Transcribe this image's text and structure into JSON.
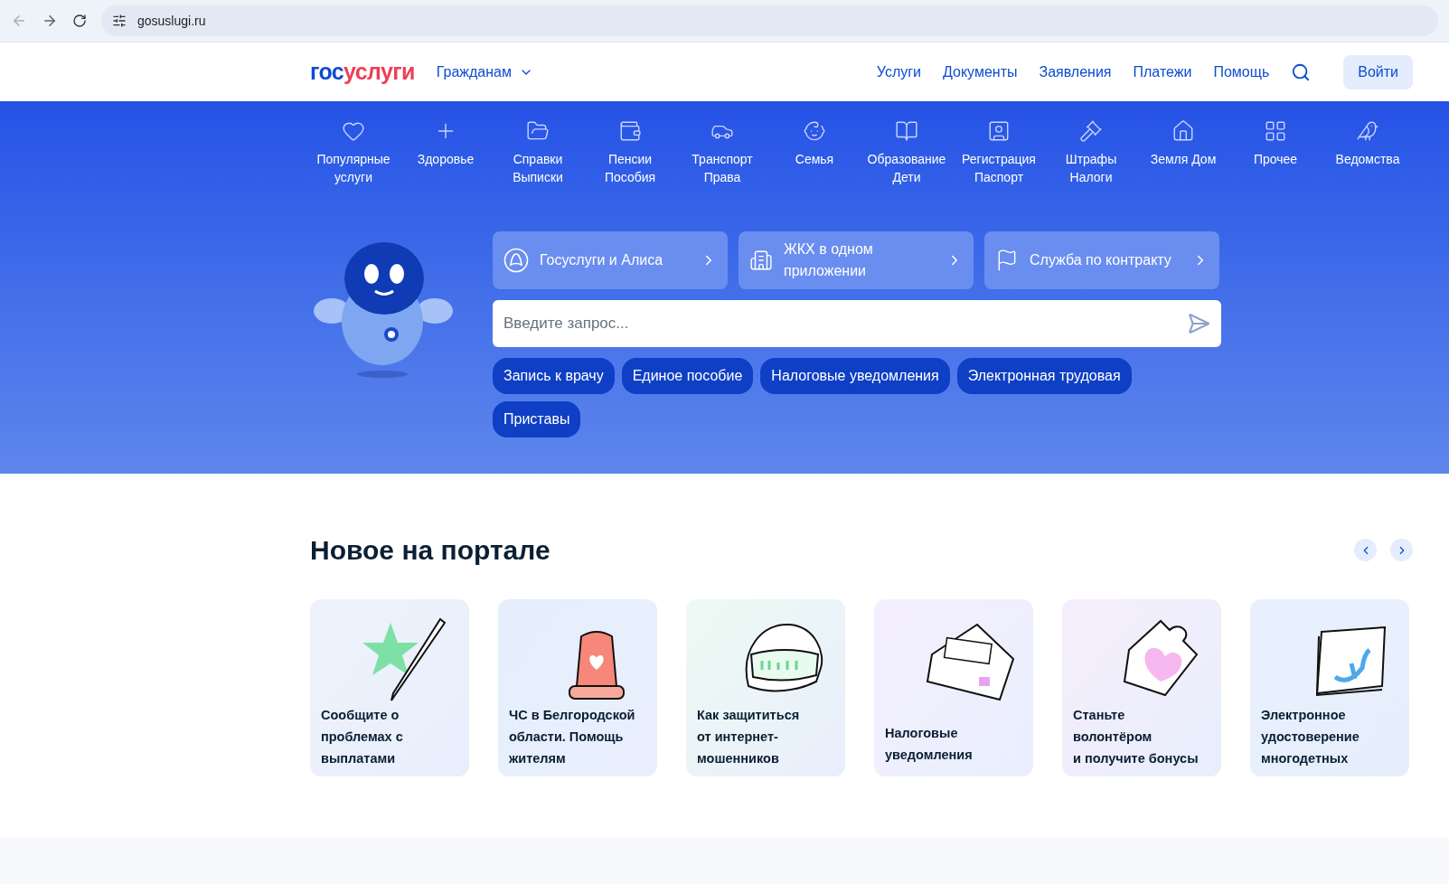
{
  "browser": {
    "url": "gosuslugi.ru"
  },
  "header": {
    "logo": [
      {
        "text": "гос",
        "color": "#0d4cd3"
      },
      {
        "text": "услуги",
        "color": "#ee3f58"
      }
    ],
    "audience": "Гражданам",
    "links": [
      "Услуги",
      "Документы",
      "Заявления",
      "Платежи",
      "Помощь"
    ],
    "login": "Войти"
  },
  "categories": [
    {
      "lines": [
        "Популярные",
        "услуги"
      ]
    },
    {
      "lines": [
        "Здоровье"
      ]
    },
    {
      "lines": [
        "Справки",
        "Выписки"
      ]
    },
    {
      "lines": [
        "Пенсии",
        "Пособия"
      ]
    },
    {
      "lines": [
        "Транспорт",
        "Права"
      ]
    },
    {
      "lines": [
        "Семья"
      ]
    },
    {
      "lines": [
        "Образование",
        "Дети"
      ]
    },
    {
      "lines": [
        "Регистрация",
        "Паспорт"
      ]
    },
    {
      "lines": [
        "Штрафы",
        "Налоги"
      ]
    },
    {
      "lines": [
        "Земля Дом"
      ]
    },
    {
      "lines": [
        "Прочее"
      ]
    },
    {
      "lines": [
        "Ведомства"
      ]
    }
  ],
  "promos": [
    {
      "lines": [
        "Госуслуги и Алиса"
      ]
    },
    {
      "lines": [
        "ЖКХ в одном",
        "приложении"
      ]
    },
    {
      "lines": [
        "Служба по контракту"
      ]
    }
  ],
  "search": {
    "placeholder": "Введите запрос..."
  },
  "quick_links": [
    "Запись к врачу",
    "Единое пособие",
    "Налоговые уведомления",
    "Электронная трудовая",
    "Приставы"
  ],
  "news": {
    "title": "Новое на портале",
    "cards": [
      {
        "lines": [
          "Сообщите о",
          "проблемах с",
          "выплатами"
        ]
      },
      {
        "lines": [
          "ЧС в Белгородской",
          "области. Помощь",
          "жителям"
        ]
      },
      {
        "lines": [
          "Как защититься",
          "от интернет-",
          "мошенников"
        ]
      },
      {
        "lines": [
          "Налоговые",
          "уведомления"
        ]
      },
      {
        "lines": [
          "Станьте",
          "волонтёром",
          "и получите бонусы"
        ]
      },
      {
        "lines": [
          "Электронное",
          "удостоверение",
          "многодетных"
        ]
      }
    ]
  }
}
